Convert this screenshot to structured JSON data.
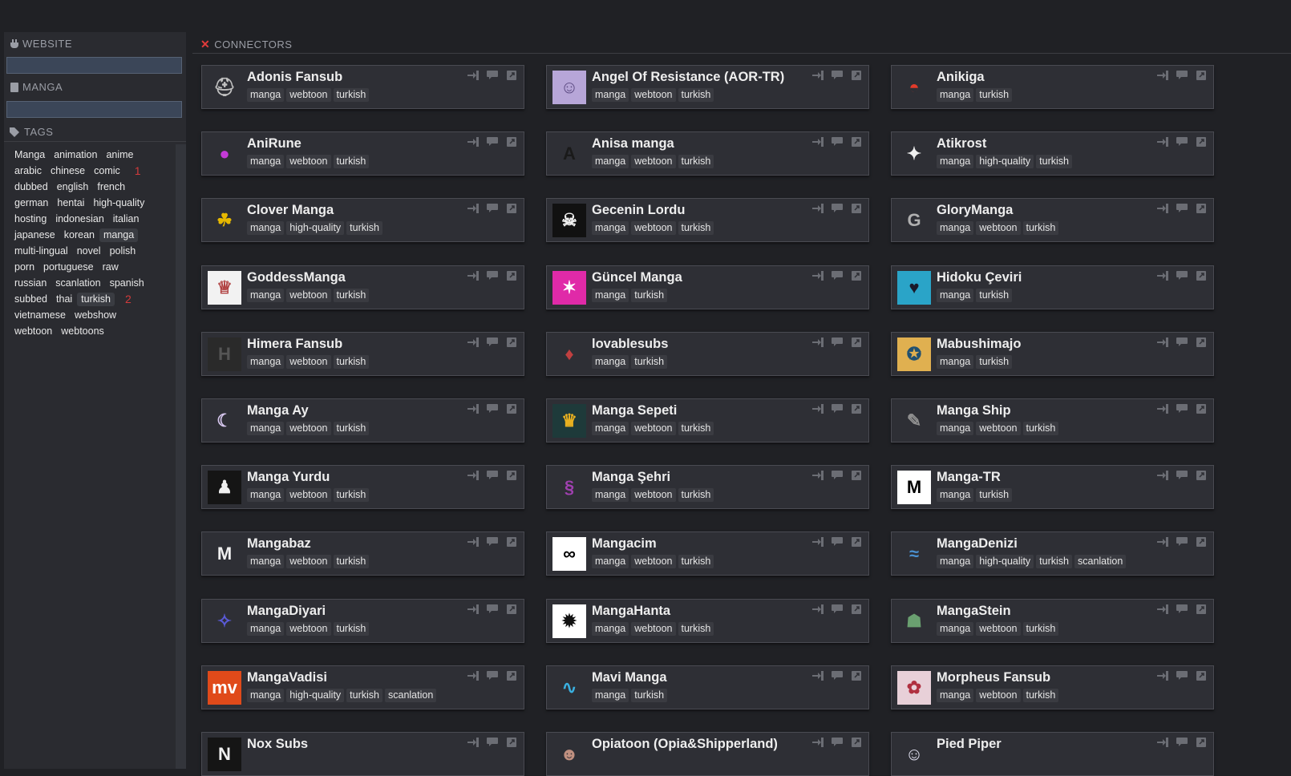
{
  "sidebar": {
    "website_header": "WEBSITE",
    "manga_header": "MANGA",
    "tags_header": "TAGS",
    "tag_rows": [
      [
        {
          "label": "Manga"
        },
        {
          "label": "animation"
        },
        {
          "label": "anime"
        }
      ],
      [
        {
          "label": "arabic"
        },
        {
          "label": "chinese"
        },
        {
          "label": "comic"
        }
      ],
      [
        {
          "label": "dubbed"
        },
        {
          "label": "english"
        },
        {
          "label": "french"
        }
      ],
      [
        {
          "label": "german"
        },
        {
          "label": "hentai"
        },
        {
          "label": "high-quality"
        }
      ],
      [
        {
          "label": "hosting"
        },
        {
          "label": "indonesian"
        },
        {
          "label": "italian"
        }
      ],
      [
        {
          "label": "japanese"
        },
        {
          "label": "korean"
        },
        {
          "label": "manga",
          "selected": true
        }
      ],
      [
        {
          "label": "multi-lingual"
        },
        {
          "label": "novel"
        },
        {
          "label": "polish"
        }
      ],
      [
        {
          "label": "porn"
        },
        {
          "label": "portuguese"
        },
        {
          "label": "raw"
        }
      ],
      [
        {
          "label": "russian"
        },
        {
          "label": "scanlation"
        },
        {
          "label": "spanish"
        }
      ],
      [
        {
          "label": "subbed"
        },
        {
          "label": "thai"
        },
        {
          "label": "turkish",
          "selected": true
        }
      ],
      [
        {
          "label": "vietnamese"
        },
        {
          "label": "webshow"
        }
      ],
      [
        {
          "label": "webtoon"
        },
        {
          "label": "webtoons"
        }
      ]
    ],
    "markers": {
      "1": "1",
      "9": "2"
    }
  },
  "main": {
    "header": "CONNECTORS"
  },
  "connectors": [
    {
      "title": "Adonis Fansub",
      "tags": [
        "manga",
        "webtoon",
        "turkish"
      ],
      "logo_icon": "helmet-logo",
      "logo_bg": "#2e2f35",
      "logo_fg": "#c0c0c0",
      "logo_glyph": "⛑"
    },
    {
      "title": "Angel Of Resistance (AOR-TR)",
      "tags": [
        "manga",
        "webtoon",
        "turkish"
      ],
      "logo_icon": "anime-girl-logo",
      "logo_bg": "#b7a6d8",
      "logo_fg": "#5c4a82",
      "logo_glyph": "☺"
    },
    {
      "title": "Anikiga",
      "tags": [
        "manga",
        "turkish"
      ],
      "logo_icon": "fan-logo",
      "logo_bg": "#2e2f35",
      "logo_fg": "#e23b2a",
      "logo_glyph": "◓"
    },
    {
      "title": "AniRune",
      "tags": [
        "manga",
        "webtoon",
        "turkish"
      ],
      "logo_icon": "mushroom-logo",
      "logo_bg": "#2e2f35",
      "logo_fg": "#c43ad8",
      "logo_glyph": "●"
    },
    {
      "title": "Anisa manga",
      "tags": [
        "manga",
        "webtoon",
        "turkish"
      ],
      "logo_icon": "anisa-text-logo",
      "logo_bg": "#2e2f35",
      "logo_fg": "#1a1a1a",
      "logo_glyph": "A"
    },
    {
      "title": "Atikrost",
      "tags": [
        "manga",
        "high-quality",
        "turkish"
      ],
      "logo_icon": "griffin-logo",
      "logo_bg": "#2e2f35",
      "logo_fg": "#f0f0f0",
      "logo_glyph": "✦"
    },
    {
      "title": "Clover Manga",
      "tags": [
        "manga",
        "high-quality",
        "turkish"
      ],
      "logo_icon": "clover-logo",
      "logo_bg": "#2e2f35",
      "logo_fg": "#e6b800",
      "logo_glyph": "☘"
    },
    {
      "title": "Gecenin Lordu",
      "tags": [
        "manga",
        "webtoon",
        "turkish"
      ],
      "logo_icon": "skull-logo",
      "logo_bg": "#111111",
      "logo_fg": "#f0f0f0",
      "logo_glyph": "☠"
    },
    {
      "title": "GloryManga",
      "tags": [
        "manga",
        "webtoon",
        "turkish"
      ],
      "logo_icon": "glory-logo",
      "logo_bg": "#2e2f35",
      "logo_fg": "#b0b0b0",
      "logo_glyph": "G"
    },
    {
      "title": "GoddessManga",
      "tags": [
        "manga",
        "webtoon",
        "turkish"
      ],
      "logo_icon": "goddess-logo",
      "logo_bg": "#f2f2f2",
      "logo_fg": "#b04040",
      "logo_glyph": "♕"
    },
    {
      "title": "Güncel Manga",
      "tags": [
        "manga",
        "turkish"
      ],
      "logo_icon": "runner-logo",
      "logo_bg": "#e02aa8",
      "logo_fg": "#ffffff",
      "logo_glyph": "✶"
    },
    {
      "title": "Hidoku Çeviri",
      "tags": [
        "manga",
        "turkish"
      ],
      "logo_icon": "character-logo",
      "logo_bg": "#2aa4c8",
      "logo_fg": "#1a1a2a",
      "logo_glyph": "♥"
    },
    {
      "title": "Himera Fansub",
      "tags": [
        "manga",
        "webtoon",
        "turkish"
      ],
      "logo_icon": "himera-logo",
      "logo_bg": "#2a2a2a",
      "logo_fg": "#555555",
      "logo_glyph": "H"
    },
    {
      "title": "lovablesubs",
      "tags": [
        "manga",
        "turkish"
      ],
      "logo_icon": "character-logo",
      "logo_bg": "#2e2f35",
      "logo_fg": "#c04040",
      "logo_glyph": "♦"
    },
    {
      "title": "Mabushimajo",
      "tags": [
        "manga",
        "turkish"
      ],
      "logo_icon": "witch-logo",
      "logo_bg": "#e0b050",
      "logo_fg": "#205070",
      "logo_glyph": "✪"
    },
    {
      "title": "Manga Ay",
      "tags": [
        "manga",
        "webtoon",
        "turkish"
      ],
      "logo_icon": "moon-logo",
      "logo_bg": "#2e2f35",
      "logo_fg": "#d8c8f0",
      "logo_glyph": "☾"
    },
    {
      "title": "Manga Sepeti",
      "tags": [
        "manga",
        "webtoon",
        "turkish"
      ],
      "logo_icon": "crown-logo",
      "logo_bg": "#1e3a3a",
      "logo_fg": "#e8b020",
      "logo_glyph": "♛"
    },
    {
      "title": "Manga Ship",
      "tags": [
        "manga",
        "webtoon",
        "turkish"
      ],
      "logo_icon": "sketch-logo",
      "logo_bg": "#2e2f35",
      "logo_fg": "#909090",
      "logo_glyph": "✎"
    },
    {
      "title": "Manga Yurdu",
      "tags": [
        "manga",
        "webtoon",
        "turkish"
      ],
      "logo_icon": "figure-logo",
      "logo_bg": "#151515",
      "logo_fg": "#f0f0f0",
      "logo_glyph": "♟"
    },
    {
      "title": "Manga Şehri",
      "tags": [
        "manga",
        "webtoon",
        "turkish"
      ],
      "logo_icon": "dragon-logo",
      "logo_bg": "#2e2f35",
      "logo_fg": "#a040b0",
      "logo_glyph": "§"
    },
    {
      "title": "Manga-TR",
      "tags": [
        "manga",
        "turkish"
      ],
      "logo_icon": "m-letter-logo",
      "logo_bg": "#ffffff",
      "logo_fg": "#000000",
      "logo_glyph": "M"
    },
    {
      "title": "Mangabaz",
      "tags": [
        "manga",
        "webtoon",
        "turkish"
      ],
      "logo_icon": "mangabaz-logo",
      "logo_bg": "#2e2f35",
      "logo_fg": "#f0f0f0",
      "logo_glyph": "M"
    },
    {
      "title": "Mangacim",
      "tags": [
        "manga",
        "webtoon",
        "turkish"
      ],
      "logo_icon": "infinity-logo",
      "logo_bg": "#ffffff",
      "logo_fg": "#000000",
      "logo_glyph": "∞"
    },
    {
      "title": "MangaDenizi",
      "tags": [
        "manga",
        "high-quality",
        "turkish",
        "scanlation"
      ],
      "logo_icon": "denizi-logo",
      "logo_bg": "#2e2f35",
      "logo_fg": "#4a90d0",
      "logo_glyph": "≈"
    },
    {
      "title": "MangaDiyari",
      "tags": [
        "manga",
        "webtoon",
        "turkish"
      ],
      "logo_icon": "diyari-logo",
      "logo_bg": "#2e2f35",
      "logo_fg": "#5a5ad8",
      "logo_glyph": "✧"
    },
    {
      "title": "MangaHanta",
      "tags": [
        "manga",
        "webtoon",
        "turkish"
      ],
      "logo_icon": "hanta-logo",
      "logo_bg": "#ffffff",
      "logo_fg": "#111111",
      "logo_glyph": "✹"
    },
    {
      "title": "MangaStein",
      "tags": [
        "manga",
        "webtoon",
        "turkish"
      ],
      "logo_icon": "frankenstein-logo",
      "logo_bg": "#2e2f35",
      "logo_fg": "#6aa070",
      "logo_glyph": "☗"
    },
    {
      "title": "MangaVadisi",
      "tags": [
        "manga",
        "high-quality",
        "turkish",
        "scanlation"
      ],
      "logo_icon": "mv-logo",
      "logo_bg": "#e04a1a",
      "logo_fg": "#ffffff",
      "logo_glyph": "mv"
    },
    {
      "title": "Mavi Manga",
      "tags": [
        "manga",
        "turkish"
      ],
      "logo_icon": "wave-logo",
      "logo_bg": "#2e2f35",
      "logo_fg": "#3ab0e0",
      "logo_glyph": "∿"
    },
    {
      "title": "Morpheus Fansub",
      "tags": [
        "manga",
        "webtoon",
        "turkish"
      ],
      "logo_icon": "character-logo",
      "logo_bg": "#e8d0d8",
      "logo_fg": "#b03040",
      "logo_glyph": "✿"
    },
    {
      "title": "Nox Subs",
      "tags": [],
      "logo_icon": "nox-logo",
      "logo_bg": "#151515",
      "logo_fg": "#f0f0f0",
      "logo_glyph": "N"
    },
    {
      "title": "Opiatoon (Opia&Shipperland)",
      "tags": [],
      "logo_icon": "opia-logo",
      "logo_bg": "#2e2f35",
      "logo_fg": "#c09080",
      "logo_glyph": "☻"
    },
    {
      "title": "Pied Piper",
      "tags": [],
      "logo_icon": "piper-logo",
      "logo_bg": "#2e2f35",
      "logo_fg": "#e0e0f0",
      "logo_glyph": "☺"
    }
  ]
}
